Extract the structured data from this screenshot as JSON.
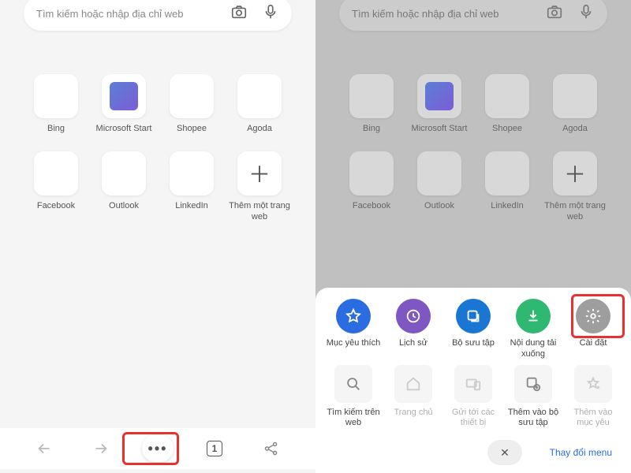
{
  "search": {
    "placeholder": "Tìm kiếm hoặc nhập địa chỉ web"
  },
  "tiles": [
    {
      "label": "Bing"
    },
    {
      "label": "Microsoft Start",
      "icon": "msstart"
    },
    {
      "label": "Shopee"
    },
    {
      "label": "Agoda"
    },
    {
      "label": "Facebook"
    },
    {
      "label": "Outlook"
    },
    {
      "label": "LinkedIn"
    },
    {
      "label": "Thêm một trang web",
      "icon": "plus"
    }
  ],
  "bottom": {
    "tab_count": "1"
  },
  "sheet": {
    "row1": [
      {
        "label": "Mục yêu thích",
        "color": "c-blue",
        "icon": "star"
      },
      {
        "label": "Lịch sử",
        "color": "c-purple",
        "icon": "history"
      },
      {
        "label": "Bộ sưu tập",
        "color": "c-blue2",
        "icon": "collection"
      },
      {
        "label": "Nội dung tải xuống",
        "color": "c-green",
        "icon": "download"
      },
      {
        "label": "Cài đặt",
        "color": "c-grey",
        "icon": "gear"
      }
    ],
    "row2": [
      {
        "label": "Tìm kiếm trên web",
        "icon": "search",
        "dim": false
      },
      {
        "label": "Trang chủ",
        "icon": "home",
        "dim": true
      },
      {
        "label": "Gửi tới các thiết bị",
        "icon": "devices",
        "dim": true
      },
      {
        "label": "Thêm vào bộ sưu tập",
        "icon": "addcollection",
        "dim": false
      },
      {
        "label": "Thêm vào mục yêu",
        "icon": "addstar",
        "dim": true
      }
    ],
    "change_menu": "Thay đổi menu",
    "close": "✕"
  }
}
